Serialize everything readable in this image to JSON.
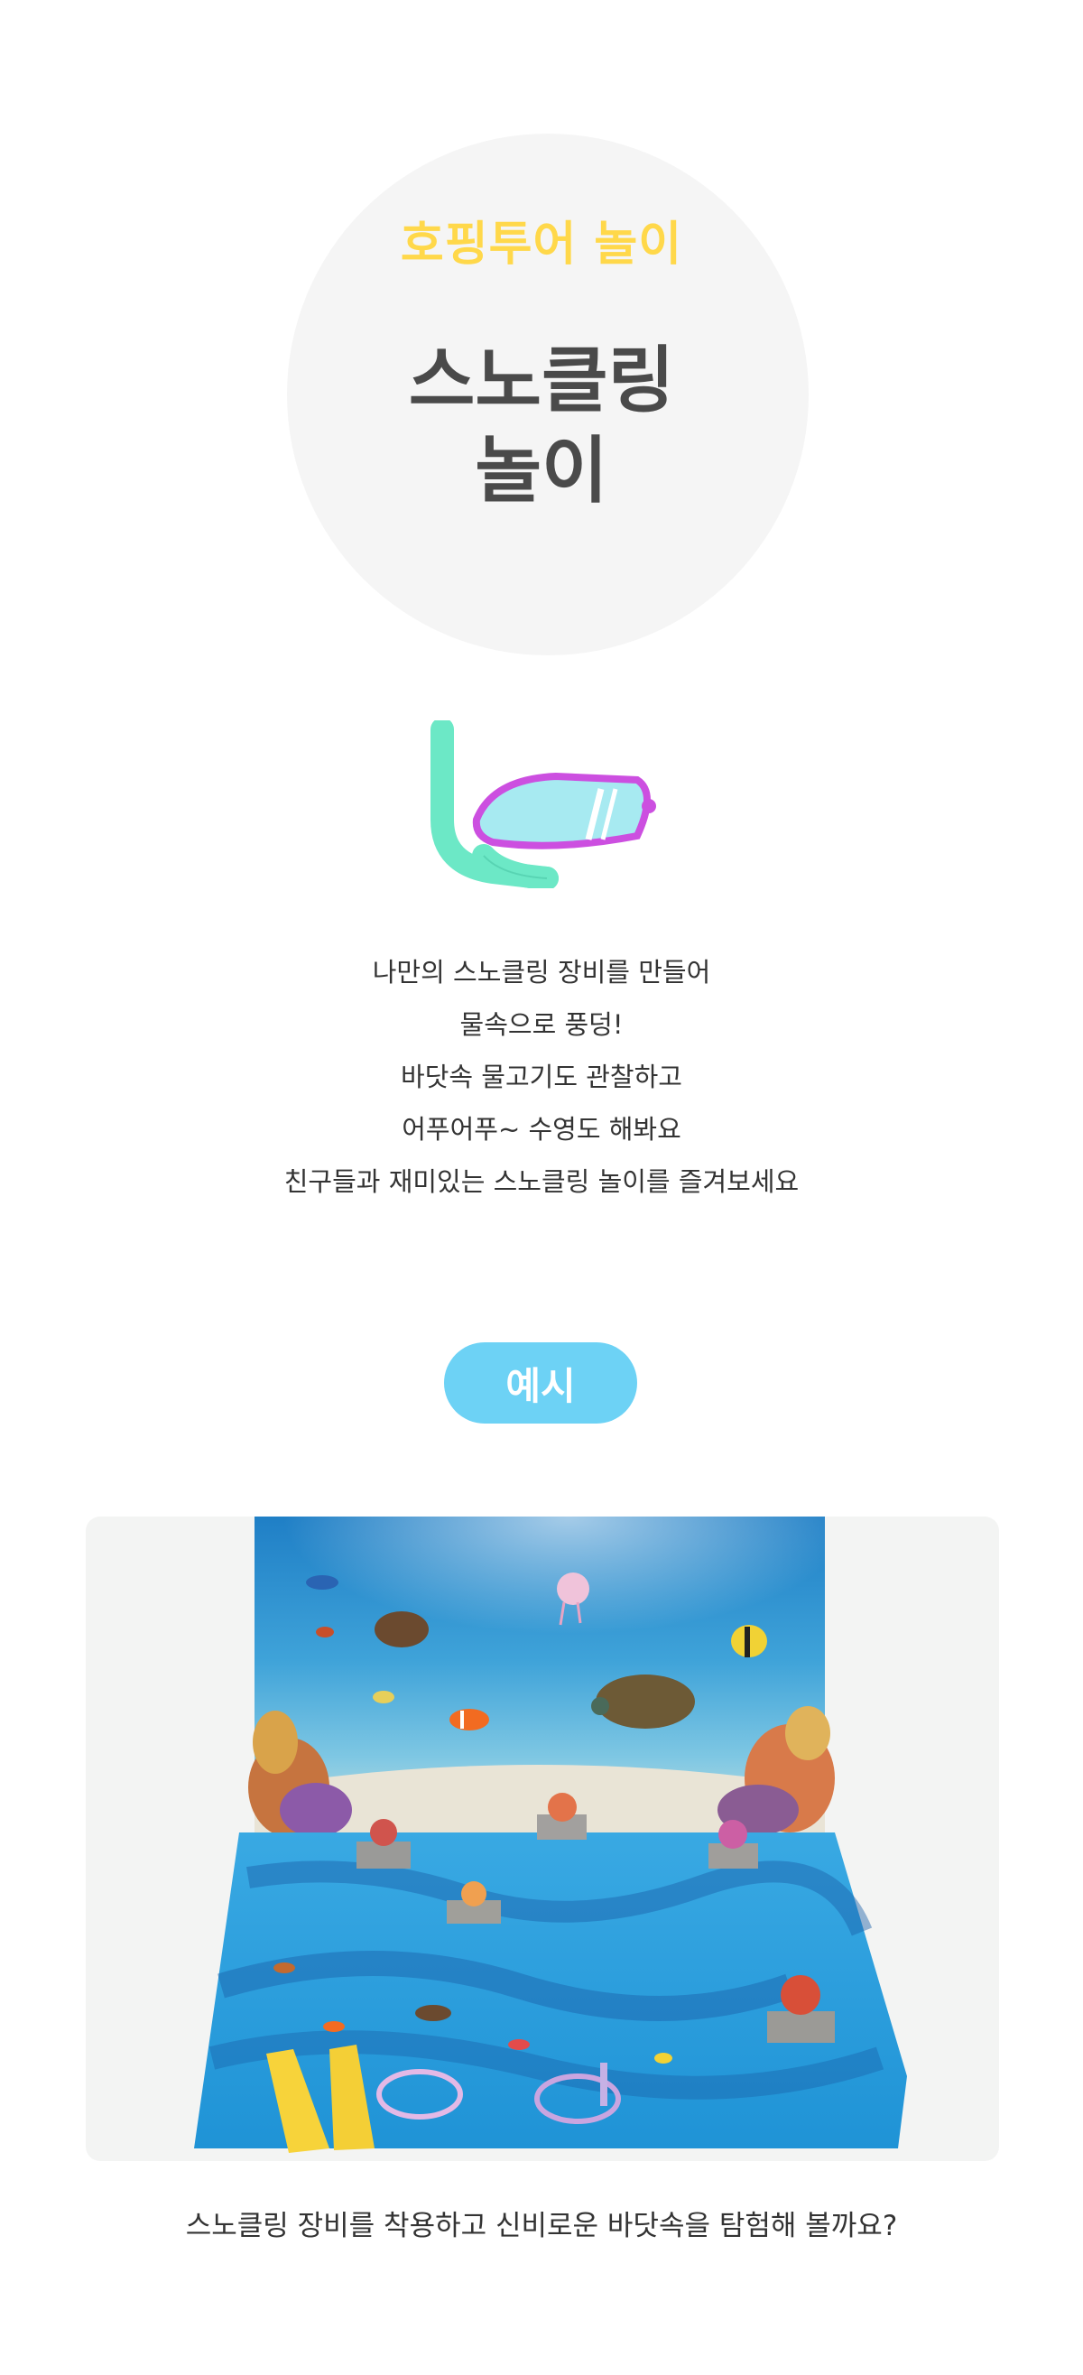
{
  "hero": {
    "subtitle": "호핑투어 놀이",
    "title_line1": "스노클링",
    "title_line2": "놀이"
  },
  "description": {
    "lines": [
      "나만의 스노클링 장비를 만들어",
      "물속으로 풍덩!",
      "바닷속 물고기도 관찰하고",
      "어푸어푸~ 수영도 해봐요",
      "친구들과 재미있는 스노클링 놀이를 즐겨보세요"
    ]
  },
  "example": {
    "label": "예시",
    "caption": "스노클링 장비를 착용하고 신비로운 바닷속을 탐험해 볼까요?"
  },
  "colors": {
    "subtitle": "#ffd84a",
    "title": "#4a4a4a",
    "pill": "#6dd2f5",
    "circle": "#f5f5f5"
  }
}
